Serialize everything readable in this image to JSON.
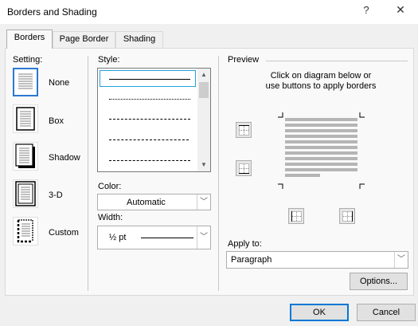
{
  "dialog": {
    "title": "Borders and Shading",
    "help_symbol": "?",
    "close_symbol": "✕"
  },
  "tabs": [
    {
      "label": "Borders",
      "active": true
    },
    {
      "label": "Page Border",
      "active": false
    },
    {
      "label": "Shading",
      "active": false
    }
  ],
  "setting": {
    "heading": "Setting:",
    "options": [
      {
        "label": "None",
        "selected": true
      },
      {
        "label": "Box",
        "selected": false
      },
      {
        "label": "Shadow",
        "selected": false
      },
      {
        "label": "3-D",
        "selected": false
      },
      {
        "label": "Custom",
        "selected": false
      }
    ]
  },
  "style": {
    "heading": "Style:",
    "selected_index": 0
  },
  "color": {
    "heading": "Color:",
    "value": "Automatic"
  },
  "width": {
    "heading": "Width:",
    "value": "½ pt"
  },
  "preview": {
    "heading": "Preview",
    "instruction_line1": "Click on diagram below or",
    "instruction_line2": "use buttons to apply borders"
  },
  "apply_to": {
    "heading": "Apply to:",
    "value": "Paragraph"
  },
  "buttons": {
    "options": "Options...",
    "ok": "OK",
    "cancel": "Cancel"
  },
  "colors": {
    "accent": "#0078d7",
    "selection": "#2b78d0"
  }
}
